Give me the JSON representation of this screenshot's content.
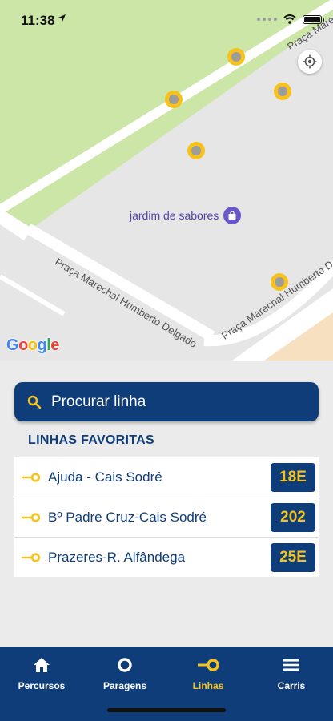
{
  "status": {
    "time": "11:38"
  },
  "map": {
    "poi_label": "jardim de sabores",
    "streets": {
      "top_right": "Praça Marechal Hum",
      "diag": "Praça Marechal Humberto Delgado",
      "right": "Praça Marechal Humberto D"
    },
    "logo": [
      "G",
      "o",
      "o",
      "g",
      "l",
      "e"
    ],
    "logo_colors": [
      "#4285f4",
      "#ea4335",
      "#fbbc05",
      "#4285f4",
      "#34a853",
      "#ea4335"
    ]
  },
  "search": {
    "placeholder": "Procurar linha"
  },
  "favorites": {
    "title": "LINHAS FAVORITAS",
    "items": [
      {
        "name": "Ajuda - Cais Sodré",
        "line": "18E"
      },
      {
        "name": "Bº Padre Cruz-Cais Sodré",
        "line": "202"
      },
      {
        "name": "Prazeres-R. Alfândega",
        "line": "25E"
      }
    ]
  },
  "tabs": [
    {
      "label": "Percursos",
      "icon": "home-icon"
    },
    {
      "label": "Paragens",
      "icon": "stop-icon"
    },
    {
      "label": "Linhas",
      "icon": "line-icon",
      "active": true
    },
    {
      "label": "Carris",
      "icon": "menu-icon"
    }
  ],
  "colors": {
    "brand": "#0f3d7a",
    "accent": "#f6c21b",
    "park": "#cbe6a6"
  }
}
